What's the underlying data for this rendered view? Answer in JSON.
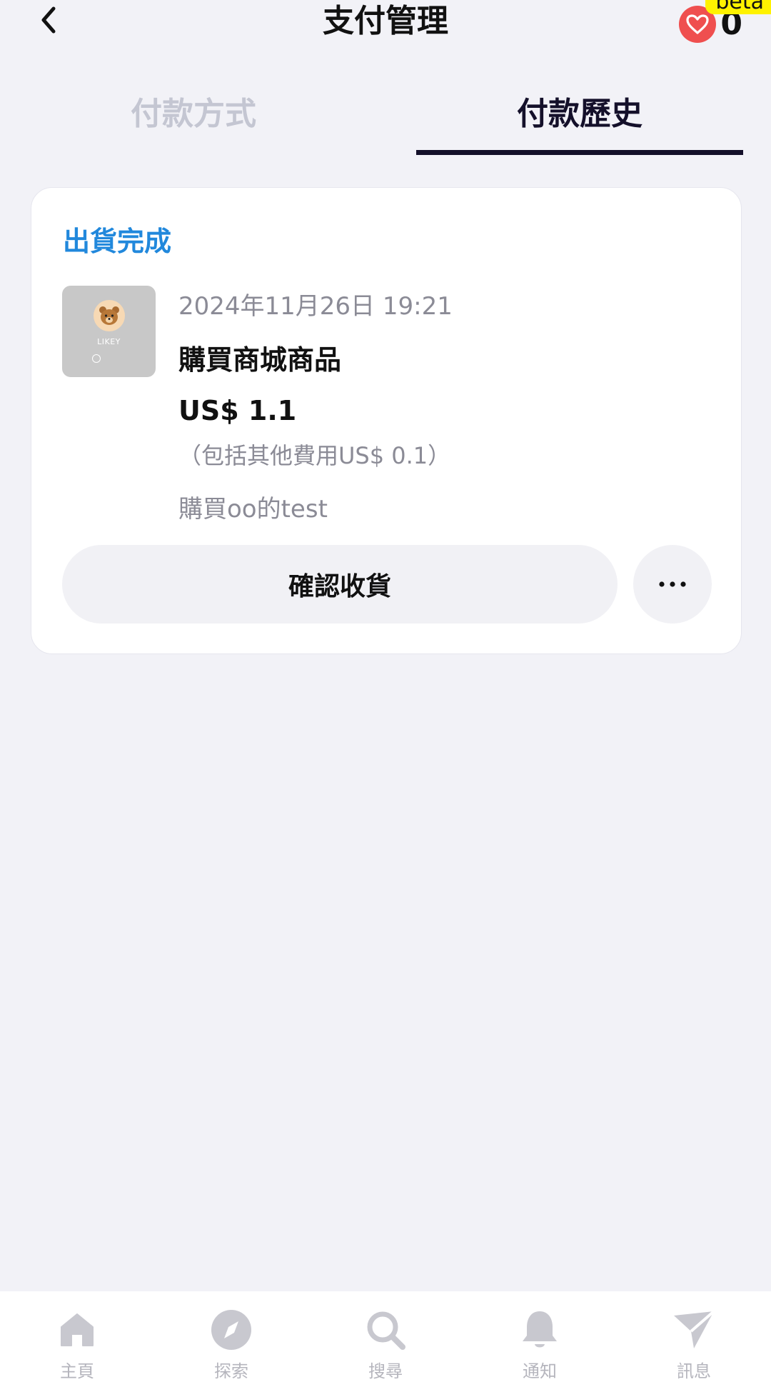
{
  "header": {
    "title": "支付管理",
    "beta_badge": "beta",
    "like_count": "0"
  },
  "tabs": [
    {
      "label": "付款方式",
      "active": false
    },
    {
      "label": "付款歷史",
      "active": true
    }
  ],
  "order": {
    "status": "出貨完成",
    "thumbnail_text": "LIKEY",
    "date": "2024年11月26日 19:21",
    "title": "購買商城商品",
    "price": "US$ 1.1",
    "fee_note": "（包括其他費用US$ 0.1）",
    "memo": "購買oo的test",
    "confirm_label": "確認收貨"
  },
  "bottom_nav": [
    {
      "label": "主頁",
      "icon": "home-icon"
    },
    {
      "label": "探索",
      "icon": "compass-icon"
    },
    {
      "label": "搜尋",
      "icon": "search-icon"
    },
    {
      "label": "通知",
      "icon": "bell-icon"
    },
    {
      "label": "訊息",
      "icon": "send-icon"
    }
  ],
  "colors": {
    "background": "#f2f2f7",
    "status_blue": "#2188dc",
    "tab_active": "#14102a",
    "tab_inactive": "#c4c6d2",
    "heart_red": "#ef4f4f",
    "beta_yellow": "#fff200",
    "nav_gray": "#b5b5bd"
  }
}
